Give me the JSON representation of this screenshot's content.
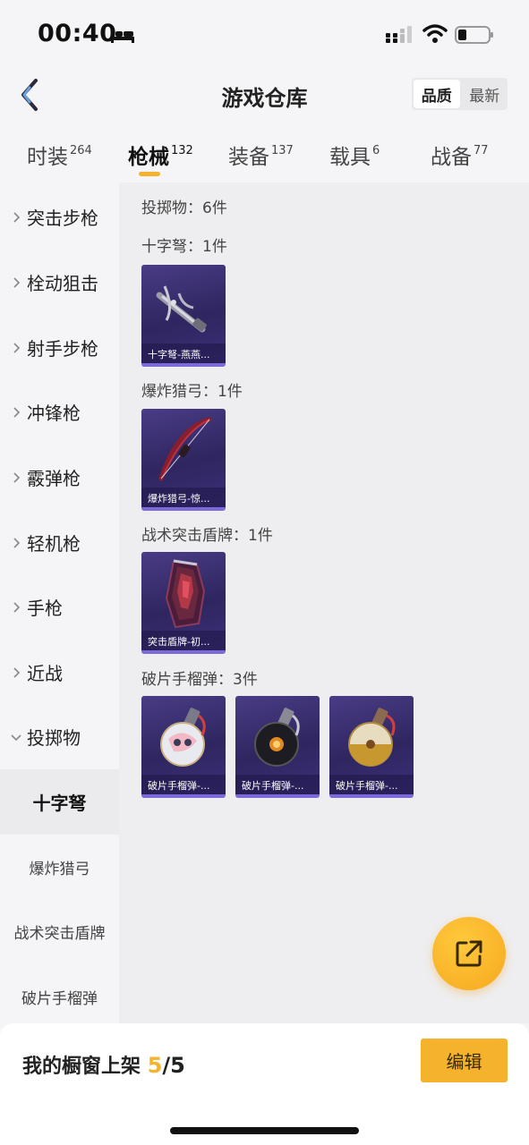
{
  "status_bar": {
    "time": "00:40"
  },
  "header": {
    "title": "游戏仓库",
    "sort_options": [
      {
        "label": "品质",
        "active": true
      },
      {
        "label": "最新",
        "active": false
      }
    ]
  },
  "tabs": [
    {
      "label": "时装",
      "count": "264",
      "active": false
    },
    {
      "label": "枪械",
      "count": "132",
      "active": true
    },
    {
      "label": "装备",
      "count": "137",
      "active": false
    },
    {
      "label": "载具",
      "count": "6",
      "active": false
    },
    {
      "label": "战备",
      "count": "77",
      "active": false
    }
  ],
  "sidebar": {
    "items": [
      {
        "label": "突击步枪",
        "expanded": false
      },
      {
        "label": "栓动狙击",
        "expanded": false
      },
      {
        "label": "射手步枪",
        "expanded": false
      },
      {
        "label": "冲锋枪",
        "expanded": false
      },
      {
        "label": "霰弹枪",
        "expanded": false
      },
      {
        "label": "轻机枪",
        "expanded": false
      },
      {
        "label": "手枪",
        "expanded": false
      },
      {
        "label": "近战",
        "expanded": false
      },
      {
        "label": "投掷物",
        "expanded": true
      }
    ],
    "sub_items": [
      {
        "label": "十字弩",
        "active": true
      },
      {
        "label": "爆炸猎弓",
        "active": false
      },
      {
        "label": "战术突击盾牌",
        "active": false
      },
      {
        "label": "破片手榴弹",
        "active": false
      }
    ]
  },
  "content": {
    "summary": "投掷物：6件",
    "groups": [
      {
        "label": "十字弩：1件",
        "items": [
          {
            "caption": "十字弩-燕燕...",
            "icon": "crossbow-art"
          }
        ]
      },
      {
        "label": "爆炸猎弓：1件",
        "items": [
          {
            "caption": "爆炸猎弓-惊...",
            "icon": "bow-art"
          }
        ]
      },
      {
        "label": "战术突击盾牌：1件",
        "items": [
          {
            "caption": "突击盾牌-初...",
            "icon": "shield-art"
          }
        ]
      },
      {
        "label": "破片手榴弹：3件",
        "items": [
          {
            "caption": "破片手榴弹-...",
            "icon": "grenade-white-art"
          },
          {
            "caption": "破片手榴弹-...",
            "icon": "grenade-black-art"
          },
          {
            "caption": "破片手榴弹-...",
            "icon": "grenade-gold-art"
          }
        ]
      }
    ]
  },
  "bottom_bar": {
    "shelf_label": "我的橱窗上架",
    "shelf_current": "5",
    "shelf_total": "/5",
    "edit_label": "编辑"
  },
  "colors": {
    "accent": "#f5b22c",
    "card_bg": "#2f2660",
    "card_border": "#7b6ad8"
  }
}
